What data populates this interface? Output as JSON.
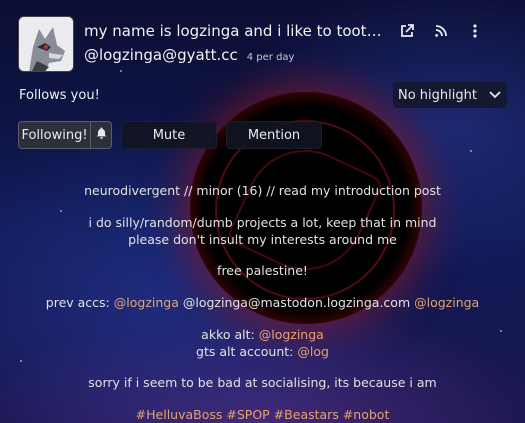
{
  "profile": {
    "display_name": "my name is logzinga and i like to toot ...",
    "handle": "@logzinga@gyatt.cc",
    "post_rate": "4 per day",
    "follows_you": "Follows you!"
  },
  "header_icons": [
    "external-link-icon",
    "rss-icon",
    "more-vertical-icon"
  ],
  "highlight": {
    "selected": "No highlight"
  },
  "actions": {
    "following_label": "Following!",
    "mute_label": "Mute",
    "mention_label": "Mention"
  },
  "bio": {
    "line1": "neurodivergent // minor (16) // read my introduction post",
    "line2a": "i do silly/random/dumb projects a lot, keep that in mind",
    "line2b": "please don't insult my interests around me",
    "line3": "free palestine!",
    "prev_accs_prefix": "prev accs:",
    "prev_acc_1": "@logzinga",
    "prev_acc_2": "@logzinga@mastodon.logzinga.com",
    "prev_acc_3": "@logzinga",
    "akko_prefix": "akko alt:",
    "akko_link": "@logzinga",
    "gts_prefix": "gts alt account:",
    "gts_link": "@log",
    "line_social": "sorry if i seem to be bad at socialising, its because i am",
    "hashtags": [
      "#HelluvaBoss",
      "#SPOP",
      "#Beastars",
      "#nobot"
    ]
  },
  "colors": {
    "link": "#e8a26a",
    "eclipse_glow": "#aa1414",
    "background": "#0b0e33"
  }
}
